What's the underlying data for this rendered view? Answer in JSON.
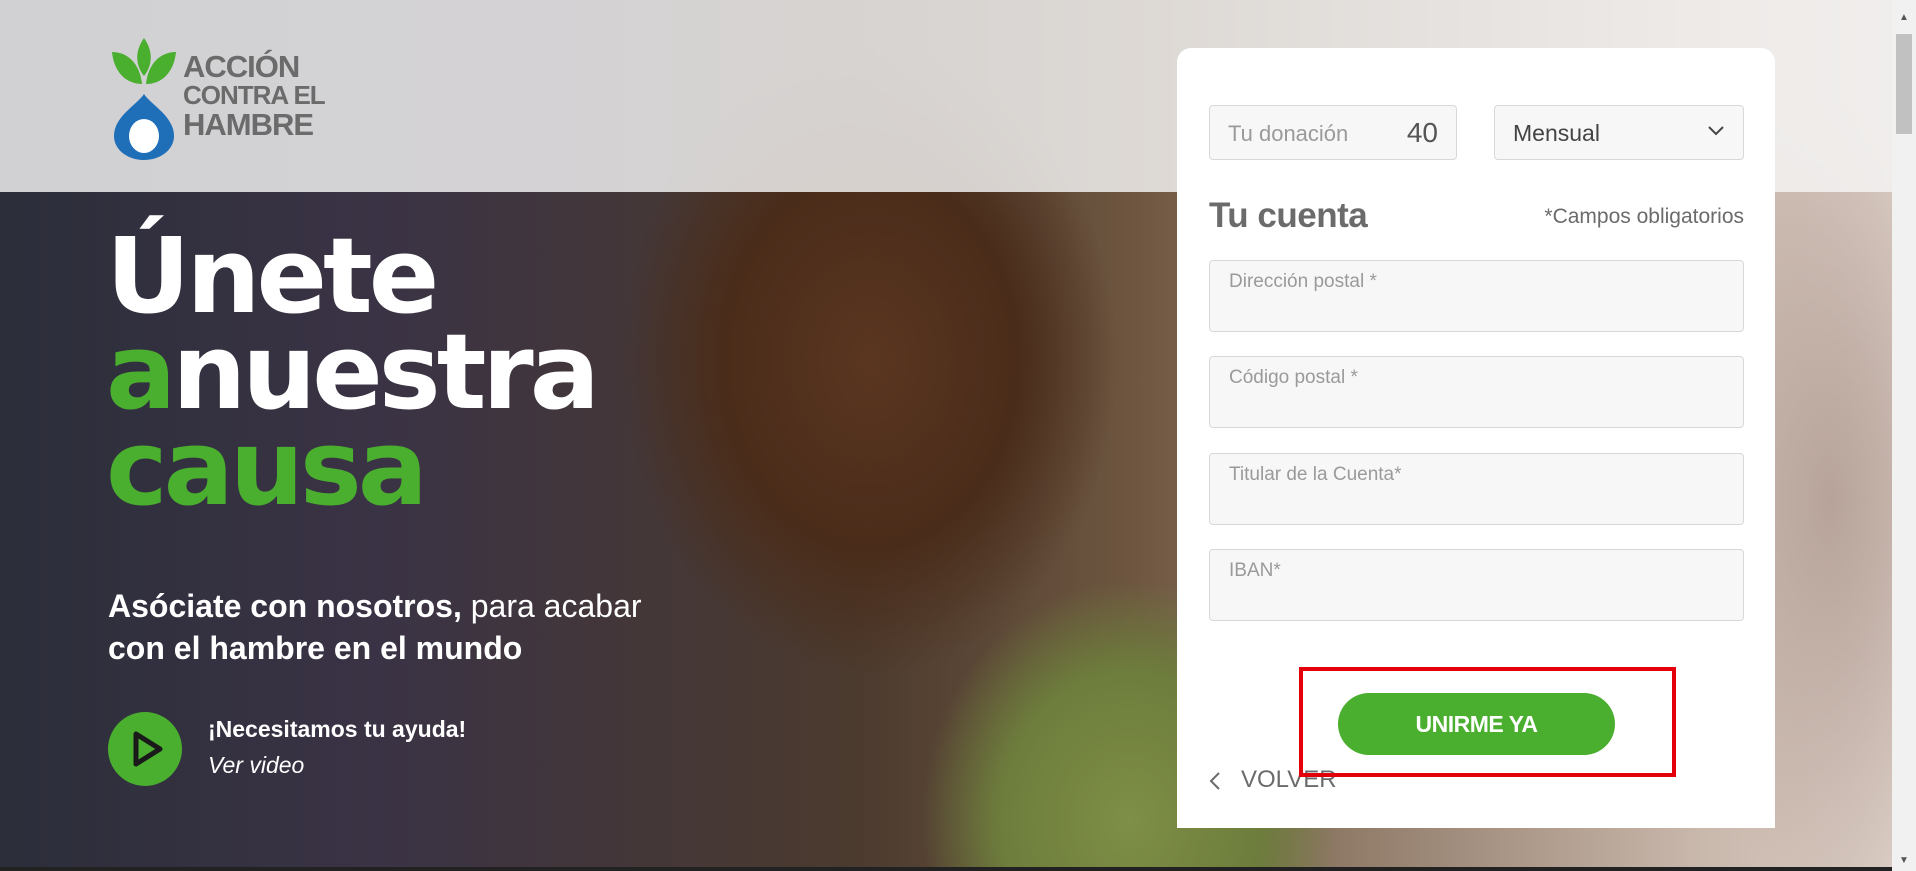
{
  "hero": {
    "headline": {
      "line1": "Únete",
      "line2_green": "a",
      "line2_white": "nuestra",
      "line3": "causa"
    },
    "subtitle_bold": "Asóciate con nosotros,",
    "subtitle_regular": " para acabar",
    "subtitle_line2": "con el hambre en el mundo",
    "video_title": "¡Necesitamos tu ayuda!",
    "video_link": "Ver video"
  },
  "logo": {
    "line1": "ACCIÓN",
    "line2": "CONTRA EL",
    "line3": "HAMBRE"
  },
  "form": {
    "donation_label": "Tu donación",
    "donation_value": "40",
    "frequency": "Mensual",
    "section_title": "Tu cuenta",
    "required_note": "*Campos obligatorios",
    "fields": [
      {
        "placeholder": "Dirección postal *"
      },
      {
        "placeholder": "Código postal *"
      },
      {
        "placeholder": "Titular de la Cuenta*"
      },
      {
        "placeholder": "IBAN*"
      }
    ],
    "submit_label": "UNIRME YA",
    "back_label": "VOLVER"
  },
  "colors": {
    "brand_green": "#4aae2f",
    "brand_blue": "#1e6fb8",
    "text_gray": "#6b6b6b",
    "highlight_red": "#e3000b"
  }
}
